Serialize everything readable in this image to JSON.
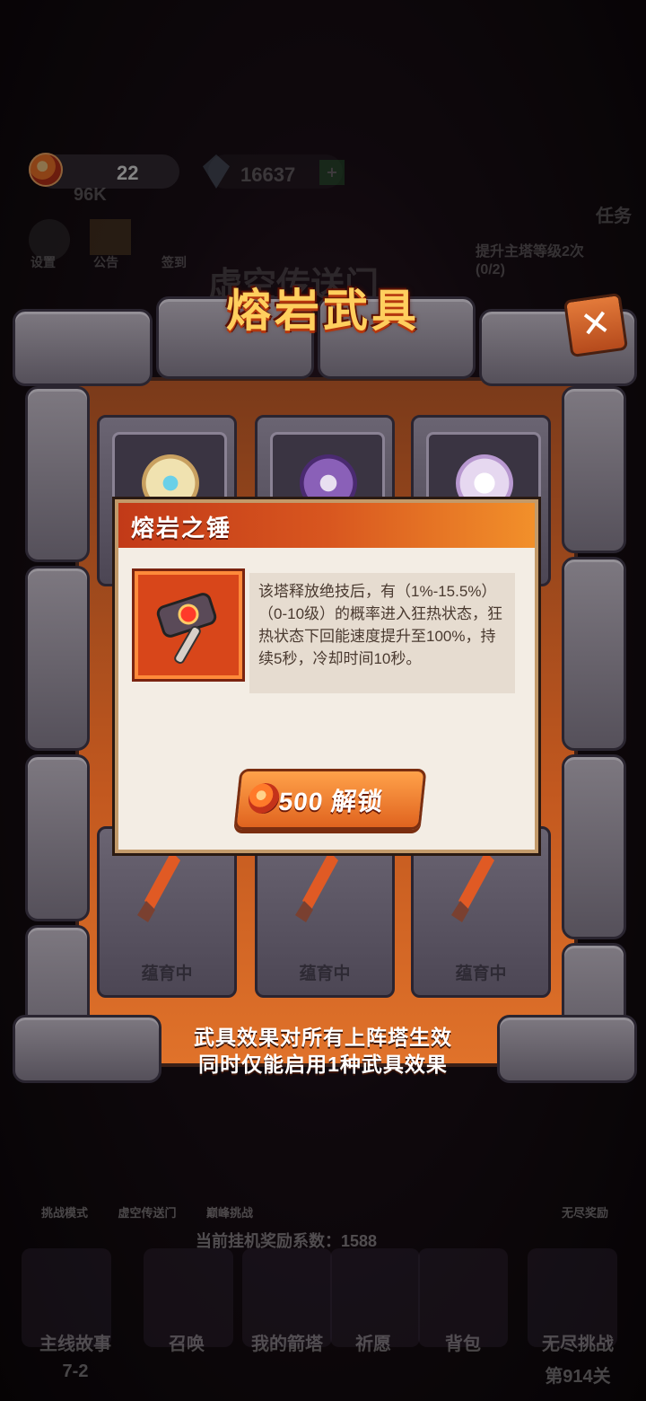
{
  "hud": {
    "currency_count": "22",
    "gems": "16637",
    "power": "96K",
    "settings_label": "设置",
    "notice_label": "公告",
    "signin_label": "签到",
    "task_label": "任务",
    "task_desc": "提升主塔等级2次",
    "task_progress": "(0/2)"
  },
  "bg_title": "虚空传送门",
  "modal": {
    "title": "熔岩武具",
    "slots": [
      {
        "label": "蕴育中"
      },
      {
        "label": "蕴育中"
      },
      {
        "label": "蕴育中"
      }
    ],
    "footer_line1": "武具效果对所有上阵塔生效",
    "footer_line2": "同时仅能启用1种武具效果"
  },
  "popup": {
    "title": "熔岩之锤",
    "description": "该塔释放绝技后，有（1%-15.5%）（0-10级）的概率进入狂热状态，狂热状态下回能速度提升至100%，持续5秒，冷却时间10秒。",
    "unlock_label": "500 解锁"
  },
  "bottom": {
    "reward_info": "当前挂机奖励系数：1588",
    "nav": [
      {
        "label": "主线故事",
        "sub": "7-2"
      },
      {
        "label": "召唤"
      },
      {
        "label": "我的箭塔"
      },
      {
        "label": "祈愿"
      },
      {
        "label": "背包"
      },
      {
        "label": "无尽挑战",
        "sub": "第914关"
      }
    ],
    "modes": [
      "挑战模式",
      "虚空传送门",
      "巅峰挑战",
      "无尽奖励"
    ]
  },
  "colors": {
    "accent": "#d8561f",
    "title_gold": "#ffcf5e",
    "popup_bg": "#f3ede4"
  }
}
